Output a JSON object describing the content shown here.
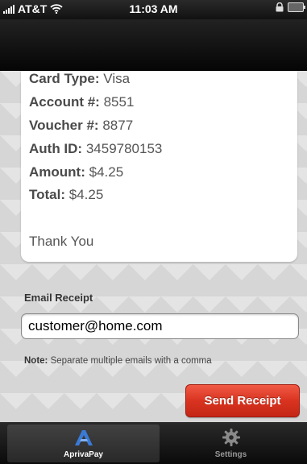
{
  "status_bar": {
    "carrier": "AT&T",
    "time": "11:03 AM"
  },
  "receipt": {
    "lines": [
      {
        "label": "Card Type:",
        "value": "Visa"
      },
      {
        "label": "Account #:",
        "value": "8551"
      },
      {
        "label": "Voucher #:",
        "value": "8877"
      },
      {
        "label": "Auth ID:",
        "value": "3459780153"
      },
      {
        "label": "Amount:",
        "value": "$4.25"
      },
      {
        "label": "Total:",
        "value": "$4.25"
      }
    ],
    "footer": "Thank You"
  },
  "email": {
    "label": "Email Receipt",
    "value": "customer@home.com",
    "note_label": "Note:",
    "note_text": "Separate multiple emails with a comma",
    "send_label": "Send Receipt"
  },
  "tabs": [
    {
      "label": "AprivaPay",
      "icon": "apriva-logo-icon",
      "active": true
    },
    {
      "label": "Settings",
      "icon": "gear-icon",
      "active": false
    }
  ],
  "colors": {
    "send_button": "#d93320",
    "tab_active_icon": "#3a7ad6"
  }
}
